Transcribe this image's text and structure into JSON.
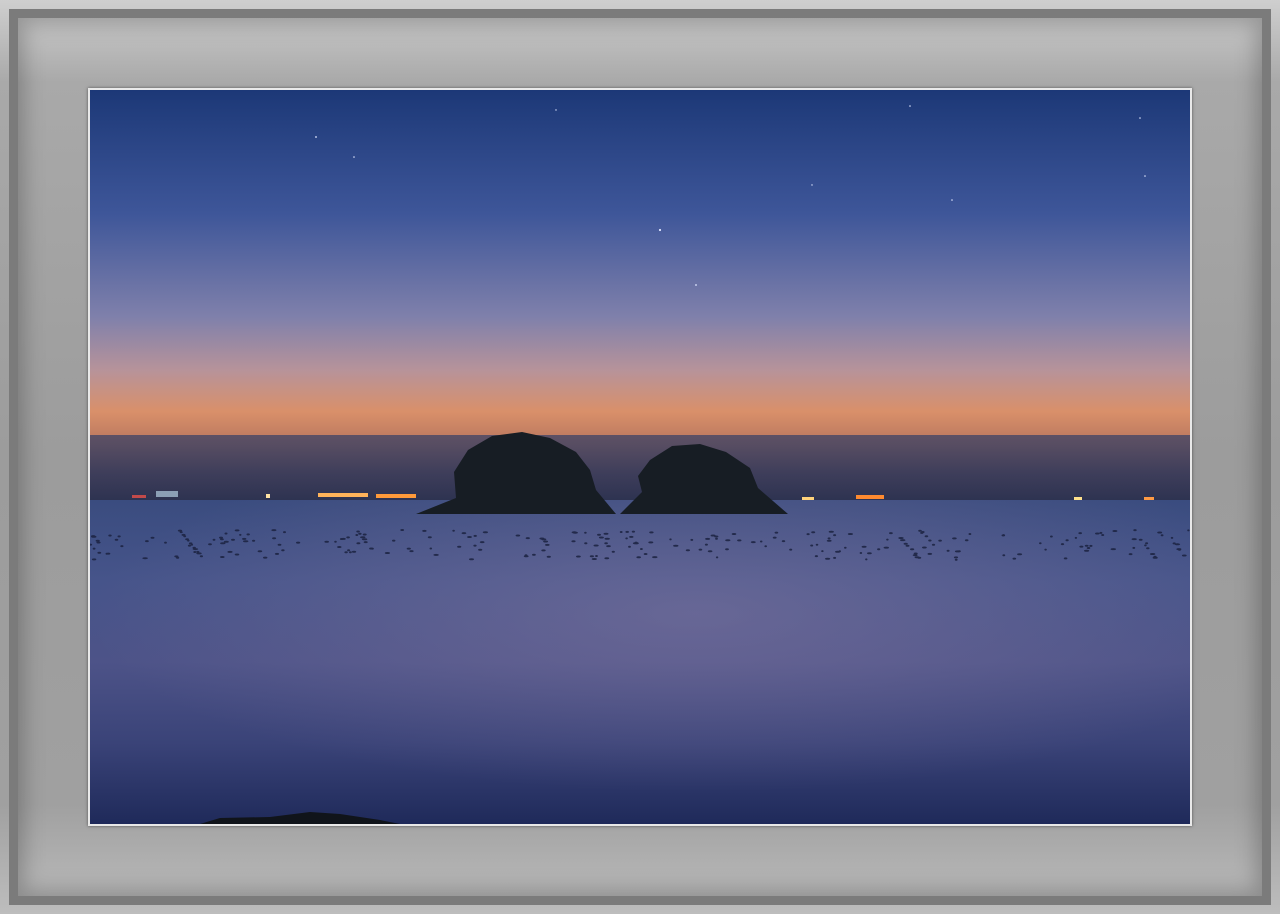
{
  "image": {
    "subject": "twilight-seascape",
    "colors": {
      "sky_top": "#1d3d78",
      "sky_mid": "#5c6aa4",
      "horizon_glow": "#d7885a",
      "sea": "#3f4a7a",
      "sea_dark": "#202c5a",
      "island": "#1a2026",
      "frame": "#9c9c9c",
      "mat_border": "#e9e9e9"
    }
  }
}
